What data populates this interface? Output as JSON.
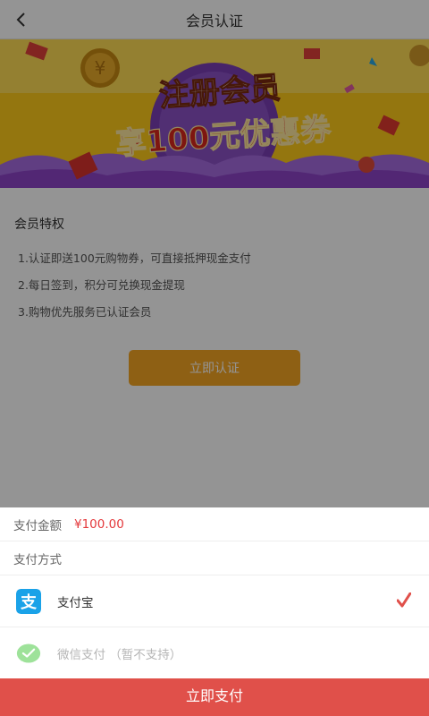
{
  "header": {
    "title": "会员认证",
    "back_icon": "chevron-left-icon"
  },
  "banner": {
    "headline": "注册会员",
    "subline": "享100元优惠券",
    "colors": {
      "background": "#ffcc1a",
      "circle": "#7b3fb5",
      "ribbon": "#8e44c9"
    }
  },
  "perks": {
    "title": "会员特权",
    "items": [
      "1.认证即送100元购物券，可直接抵押现金支付",
      "2.每日签到，积分可兑换现金提现",
      "3.购物优先服务已认证会员"
    ]
  },
  "verify_button": {
    "label": "立即认证",
    "color": "#f5a623"
  },
  "payment_sheet": {
    "amount_label": "支付金额",
    "amount_value": "¥100.00",
    "method_label": "支付方式",
    "options": [
      {
        "label": "支付宝",
        "icon": "alipay-icon",
        "selected": true
      },
      {
        "label": "微信支付 （暂不支持）",
        "icon": "wechat-pay-icon",
        "disabled": true
      }
    ],
    "pay_button": "立即支付",
    "colors": {
      "accent": "#e0504a",
      "amount": "#e4393c",
      "alipay": "#1aa2e8",
      "wechat": "#9ee29a"
    }
  }
}
